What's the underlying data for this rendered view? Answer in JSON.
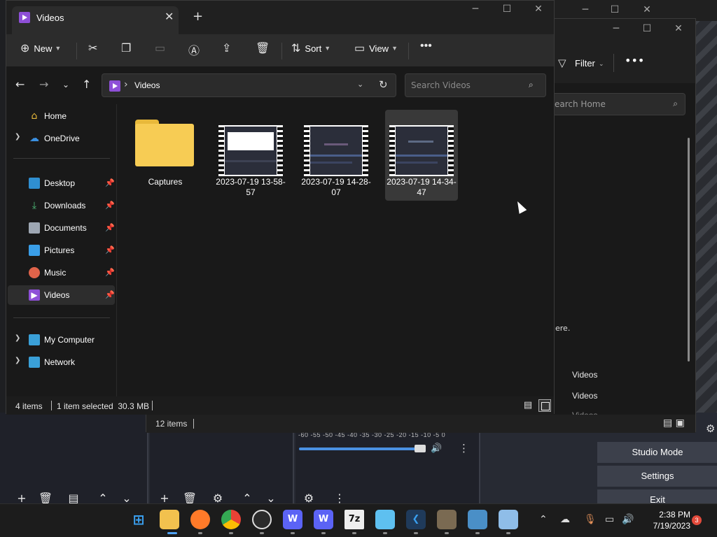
{
  "explorer": {
    "tab_title": "Videos",
    "commands": {
      "new": "New",
      "sort": "Sort",
      "view": "View"
    },
    "address": "Videos",
    "search_placeholder": "Search Videos",
    "sidebar": {
      "home": "Home",
      "onedrive": "OneDrive",
      "desktop": "Desktop",
      "downloads": "Downloads",
      "documents": "Documents",
      "pictures": "Pictures",
      "music": "Music",
      "videos": "Videos",
      "my_computer": "My Computer",
      "network": "Network"
    },
    "files": [
      {
        "name": "Captures",
        "type": "folder"
      },
      {
        "name": "2023-07-19 13-58-57",
        "type": "video"
      },
      {
        "name": "2023-07-19 14-28-07",
        "type": "video"
      },
      {
        "name": "2023-07-19 14-34-47",
        "type": "video",
        "selected": true
      }
    ],
    "status": {
      "items": "4 items",
      "selection": "1 item selected  30.3 MB"
    }
  },
  "explorer_back": {
    "filter": "Filter",
    "search_placeholder": "earch Home",
    "partial_text": "ere.",
    "rows": [
      "Videos",
      "Videos",
      "Videos"
    ],
    "status_items": "12 items"
  },
  "obs": {
    "mixer_scale": "-60 -55 -50 -45 -40 -35 -30 -25 -20 -15 -10 -5 0",
    "studio_mode": "Studio Mode",
    "settings": "Settings",
    "exit": "Exit"
  },
  "taskbar": {
    "apps": [
      "start-icon",
      "file-explorer-icon",
      "firefox-icon",
      "chrome-icon",
      "obs-icon",
      "wavebox-icon",
      "wavebox-icon",
      "7zip-icon",
      "notepad-icon",
      "vscode-icon",
      "gimp-icon",
      "terminal-icon",
      "photos-icon"
    ],
    "sevenzip_label": "7z",
    "time": "2:38 PM",
    "date": "7/19/2023",
    "notifications": "3"
  },
  "colors": {
    "accent_purple": "#8e4fd7",
    "folder_yellow": "#f7cc54",
    "badge_red": "#e24a3b"
  }
}
